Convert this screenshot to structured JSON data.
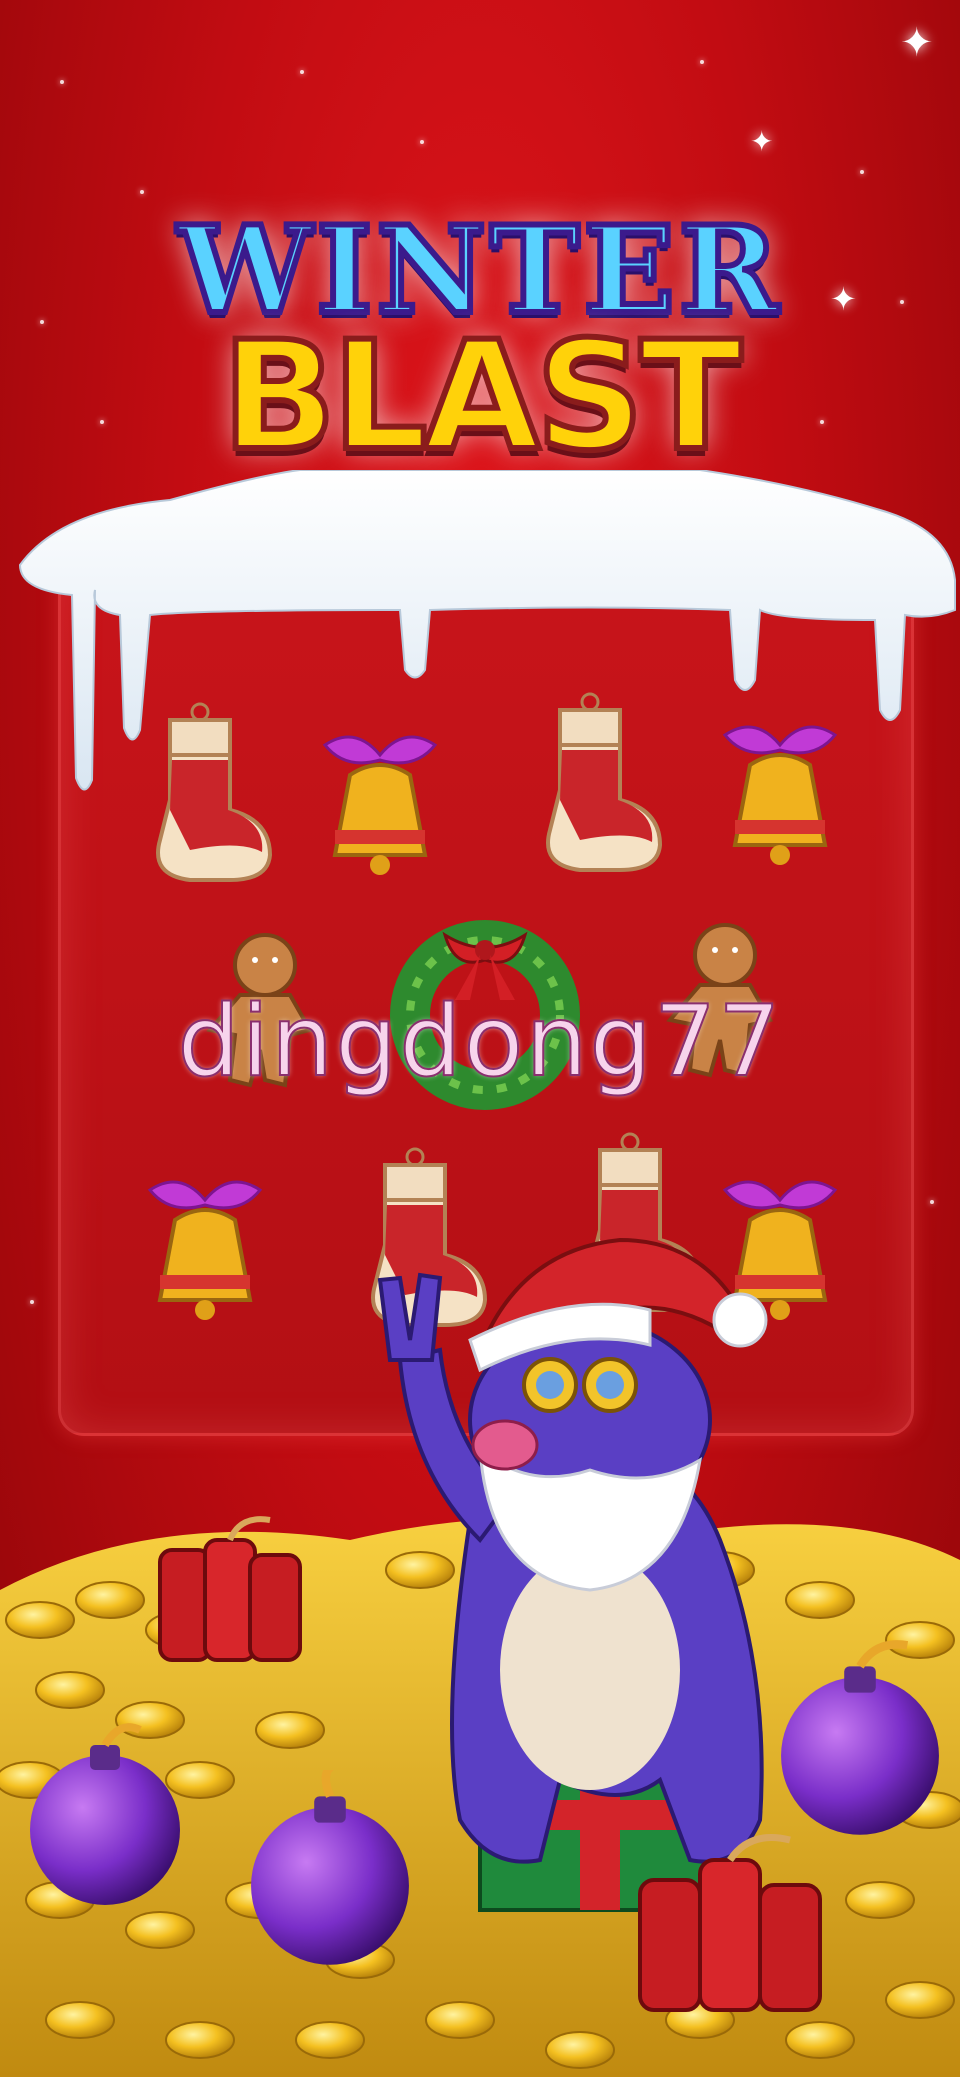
{
  "game": {
    "title_line1": "WINTER",
    "title_line2": "BLAST",
    "watermark": "dingdong77"
  },
  "board": {
    "rows": [
      [
        "stocking-icon",
        "bell-icon",
        "stocking-icon",
        "bell-icon"
      ],
      [
        "gingerbread-icon",
        "wreath-icon",
        "gingerbread-icon"
      ],
      [
        "bell-icon",
        "stocking-icon",
        "stocking-icon",
        "bell-icon"
      ]
    ]
  },
  "scene": {
    "mascot": "mole-santa-mascot",
    "props": [
      "dynamite-icon",
      "bomb-icon",
      "gift-box-icon",
      "gold-coin-icon"
    ]
  },
  "colors": {
    "background": "#c20c12",
    "title_blue": "#5ad2ff",
    "title_yellow": "#ffd20a",
    "snow": "#f2f7fb",
    "bomb_purple": "#7a2ec9",
    "coin_gold": "#f4c020"
  }
}
